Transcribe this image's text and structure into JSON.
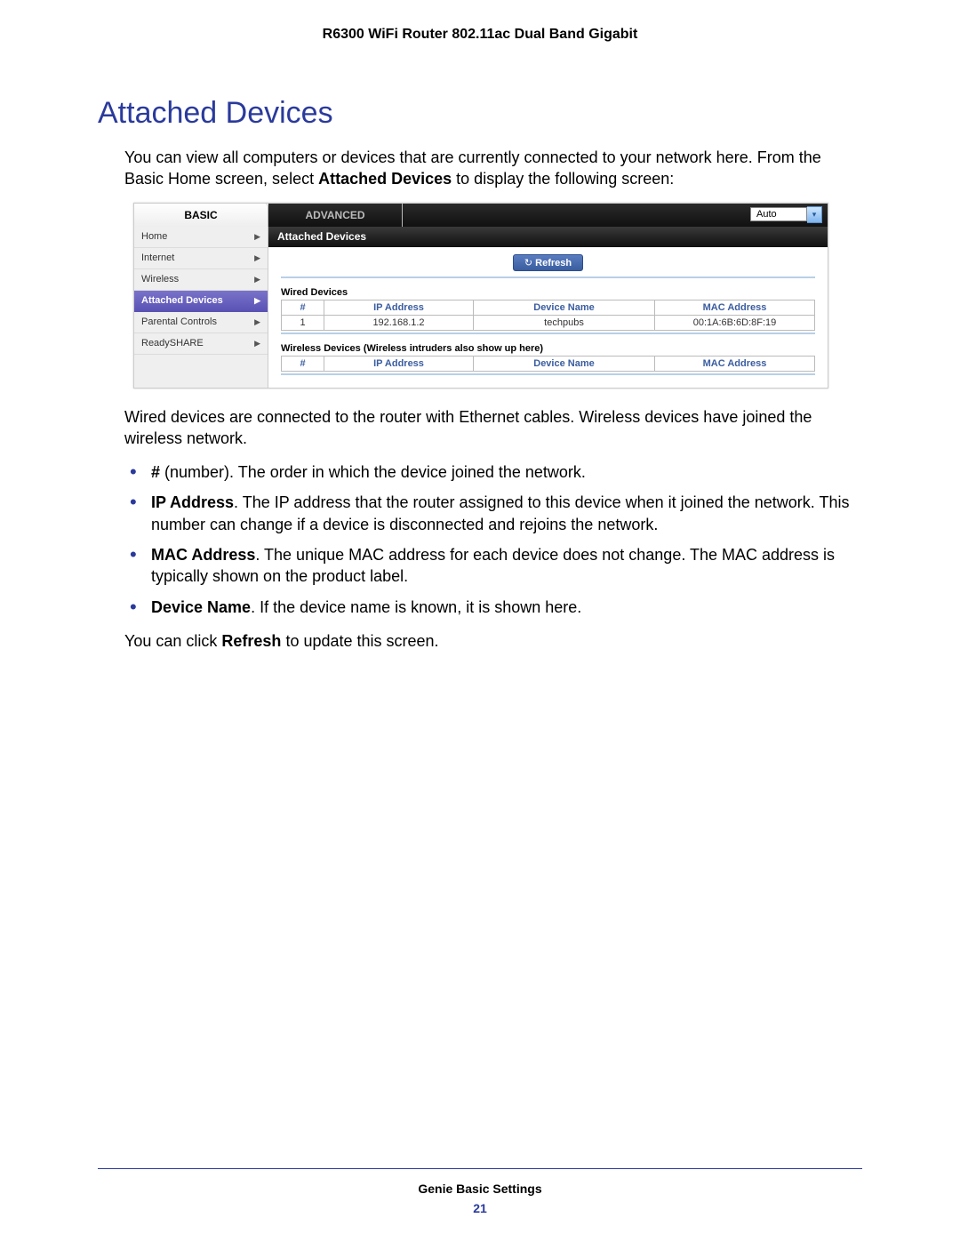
{
  "doc_header": "R6300 WiFi Router 802.11ac Dual Band Gigabit",
  "section_title": "Attached Devices",
  "intro_line1": "You can view all computers or devices that are currently connected to your network here.",
  "intro_line2_pre": "From the Basic Home screen, select ",
  "intro_line2_bold": "Attached Devices",
  "intro_line2_post": " to display the following screen:",
  "screenshot": {
    "tabs": {
      "basic": "BASIC",
      "advanced": "ADVANCED"
    },
    "language": "Auto",
    "sidebar": [
      {
        "label": "Home",
        "active": false
      },
      {
        "label": "Internet",
        "active": false
      },
      {
        "label": "Wireless",
        "active": false
      },
      {
        "label": "Attached Devices",
        "active": true
      },
      {
        "label": "Parental Controls",
        "active": false
      },
      {
        "label": "ReadySHARE",
        "active": false
      }
    ],
    "main_title": "Attached Devices",
    "refresh": "Refresh",
    "wired": {
      "label": "Wired Devices",
      "headers": {
        "num": "#",
        "ip": "IP Address",
        "name": "Device Name",
        "mac": "MAC Address"
      },
      "row": {
        "num": "1",
        "ip": "192.168.1.2",
        "name": "techpubs",
        "mac": "00:1A:6B:6D:8F:19"
      }
    },
    "wireless": {
      "label": "Wireless Devices (Wireless intruders also show up here)",
      "headers": {
        "num": "#",
        "ip": "IP Address",
        "name": "Device Name",
        "mac": "MAC Address"
      }
    }
  },
  "after_ss": "Wired devices are connected to the router with Ethernet cables. Wireless devices have joined the wireless network.",
  "bullets": [
    {
      "bold": "#",
      "post": " (number). The order in which the device joined the network."
    },
    {
      "bold": "IP Address",
      "post": ". The IP address that the router assigned to this device when it joined the network. This number can change if a device is disconnected and rejoins the network."
    },
    {
      "bold": "MAC Address",
      "post": ". The unique MAC address for each device does not change. The MAC address is typically shown on the product label."
    },
    {
      "bold": "Device Name",
      "post": ". If the device name is known, it is shown here."
    }
  ],
  "closing_pre": "You can click ",
  "closing_bold": "Refresh",
  "closing_post": " to update this screen.",
  "footer_title": "Genie Basic Settings",
  "footer_page": "21"
}
